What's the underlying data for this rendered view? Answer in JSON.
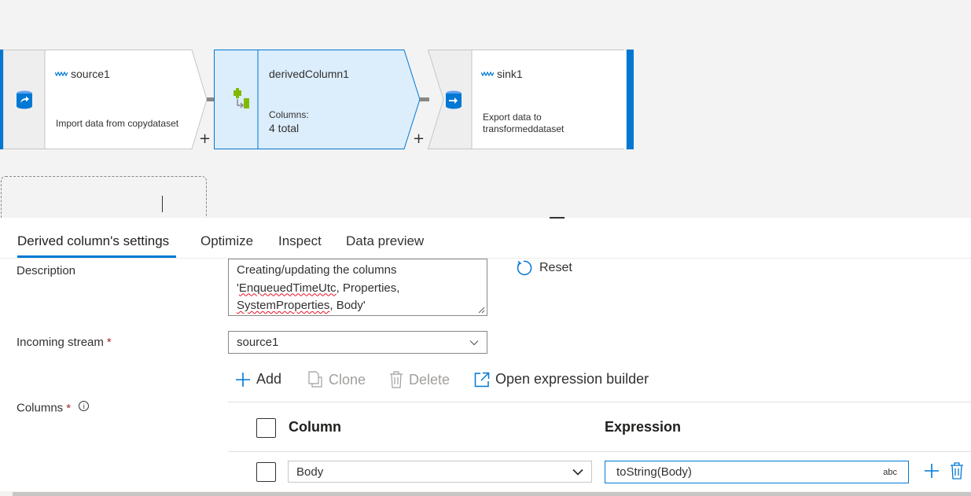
{
  "nodes": {
    "source": {
      "name": "source1",
      "desc": "Import data from copydataset"
    },
    "derived": {
      "name": "derivedColumn1",
      "columns_label": "Columns:",
      "columns_value": "4 total"
    },
    "sink": {
      "name": "sink1",
      "desc_line1": "Export data to",
      "desc_line2": "transformeddataset"
    },
    "plus_symbol": "+"
  },
  "tabs": [
    {
      "label": "Derived column's settings",
      "active": true
    },
    {
      "label": "Optimize"
    },
    {
      "label": "Inspect"
    },
    {
      "label": "Data preview"
    }
  ],
  "form": {
    "description_label": "Description",
    "description_text": {
      "line1": "Creating/updating the columns",
      "line2_prefix": "'",
      "line2_err": "EnqueuedTimeUtc",
      "line2_suffix": ", Properties,",
      "line3_err": "SystemProperties",
      "line3_suffix": ", Body'"
    },
    "reset_label": "Reset",
    "incoming_stream_label": "Incoming stream",
    "incoming_stream_value": "source1",
    "required_mark": "*",
    "columns_label": "Columns",
    "info_symbol": "i"
  },
  "toolbar": {
    "add": "Add",
    "clone": "Clone",
    "delete": "Delete",
    "open_builder": "Open expression builder"
  },
  "grid": {
    "headers": {
      "column": "Column",
      "expression": "Expression"
    },
    "rows": [
      {
        "column": "Body",
        "expression": "toString(Body)",
        "type_badge": "abc"
      }
    ]
  },
  "colors": {
    "accent": "#0078d4",
    "selected_node_fill": "#dcedfc",
    "canvas_bg": "#f3f3f3",
    "required": "#a4262c",
    "disabled": "#a19f9d"
  }
}
